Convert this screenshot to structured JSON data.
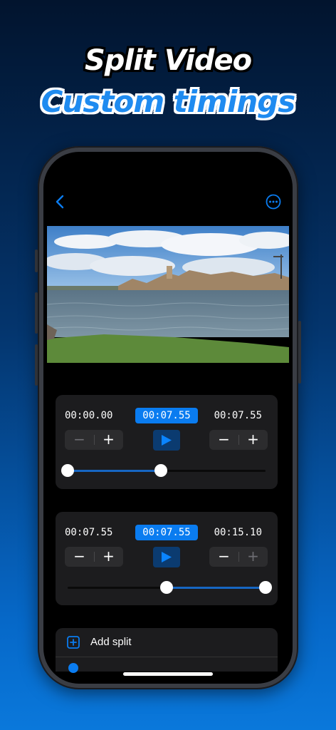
{
  "promo": {
    "title": "Split Video",
    "subtitle": "Custom timings"
  },
  "navbar": {
    "back_icon": "chevron-left-icon",
    "more_icon": "ellipsis-circle-icon",
    "accent": "#0a7cf0"
  },
  "splits": [
    {
      "start": "00:00.00",
      "current": "00:07.55",
      "end": "00:07.55",
      "range_fraction": [
        0.0,
        0.47
      ],
      "start_minus_enabled": false,
      "end_plus_enabled": true
    },
    {
      "start": "00:07.55",
      "current": "00:07.55",
      "end": "00:15.10",
      "range_fraction": [
        0.5,
        1.0
      ],
      "start_minus_enabled": true,
      "end_plus_enabled": false
    }
  ],
  "stepper": {
    "minus": "−",
    "plus": "+"
  },
  "add_split": {
    "label": "Add split",
    "icon": "plus-square-icon"
  },
  "colors": {
    "card": "#1c1c1e",
    "highlight": "#0a7cf0",
    "play_bg": "#0b3b70",
    "range_fill": "#1666c2"
  }
}
